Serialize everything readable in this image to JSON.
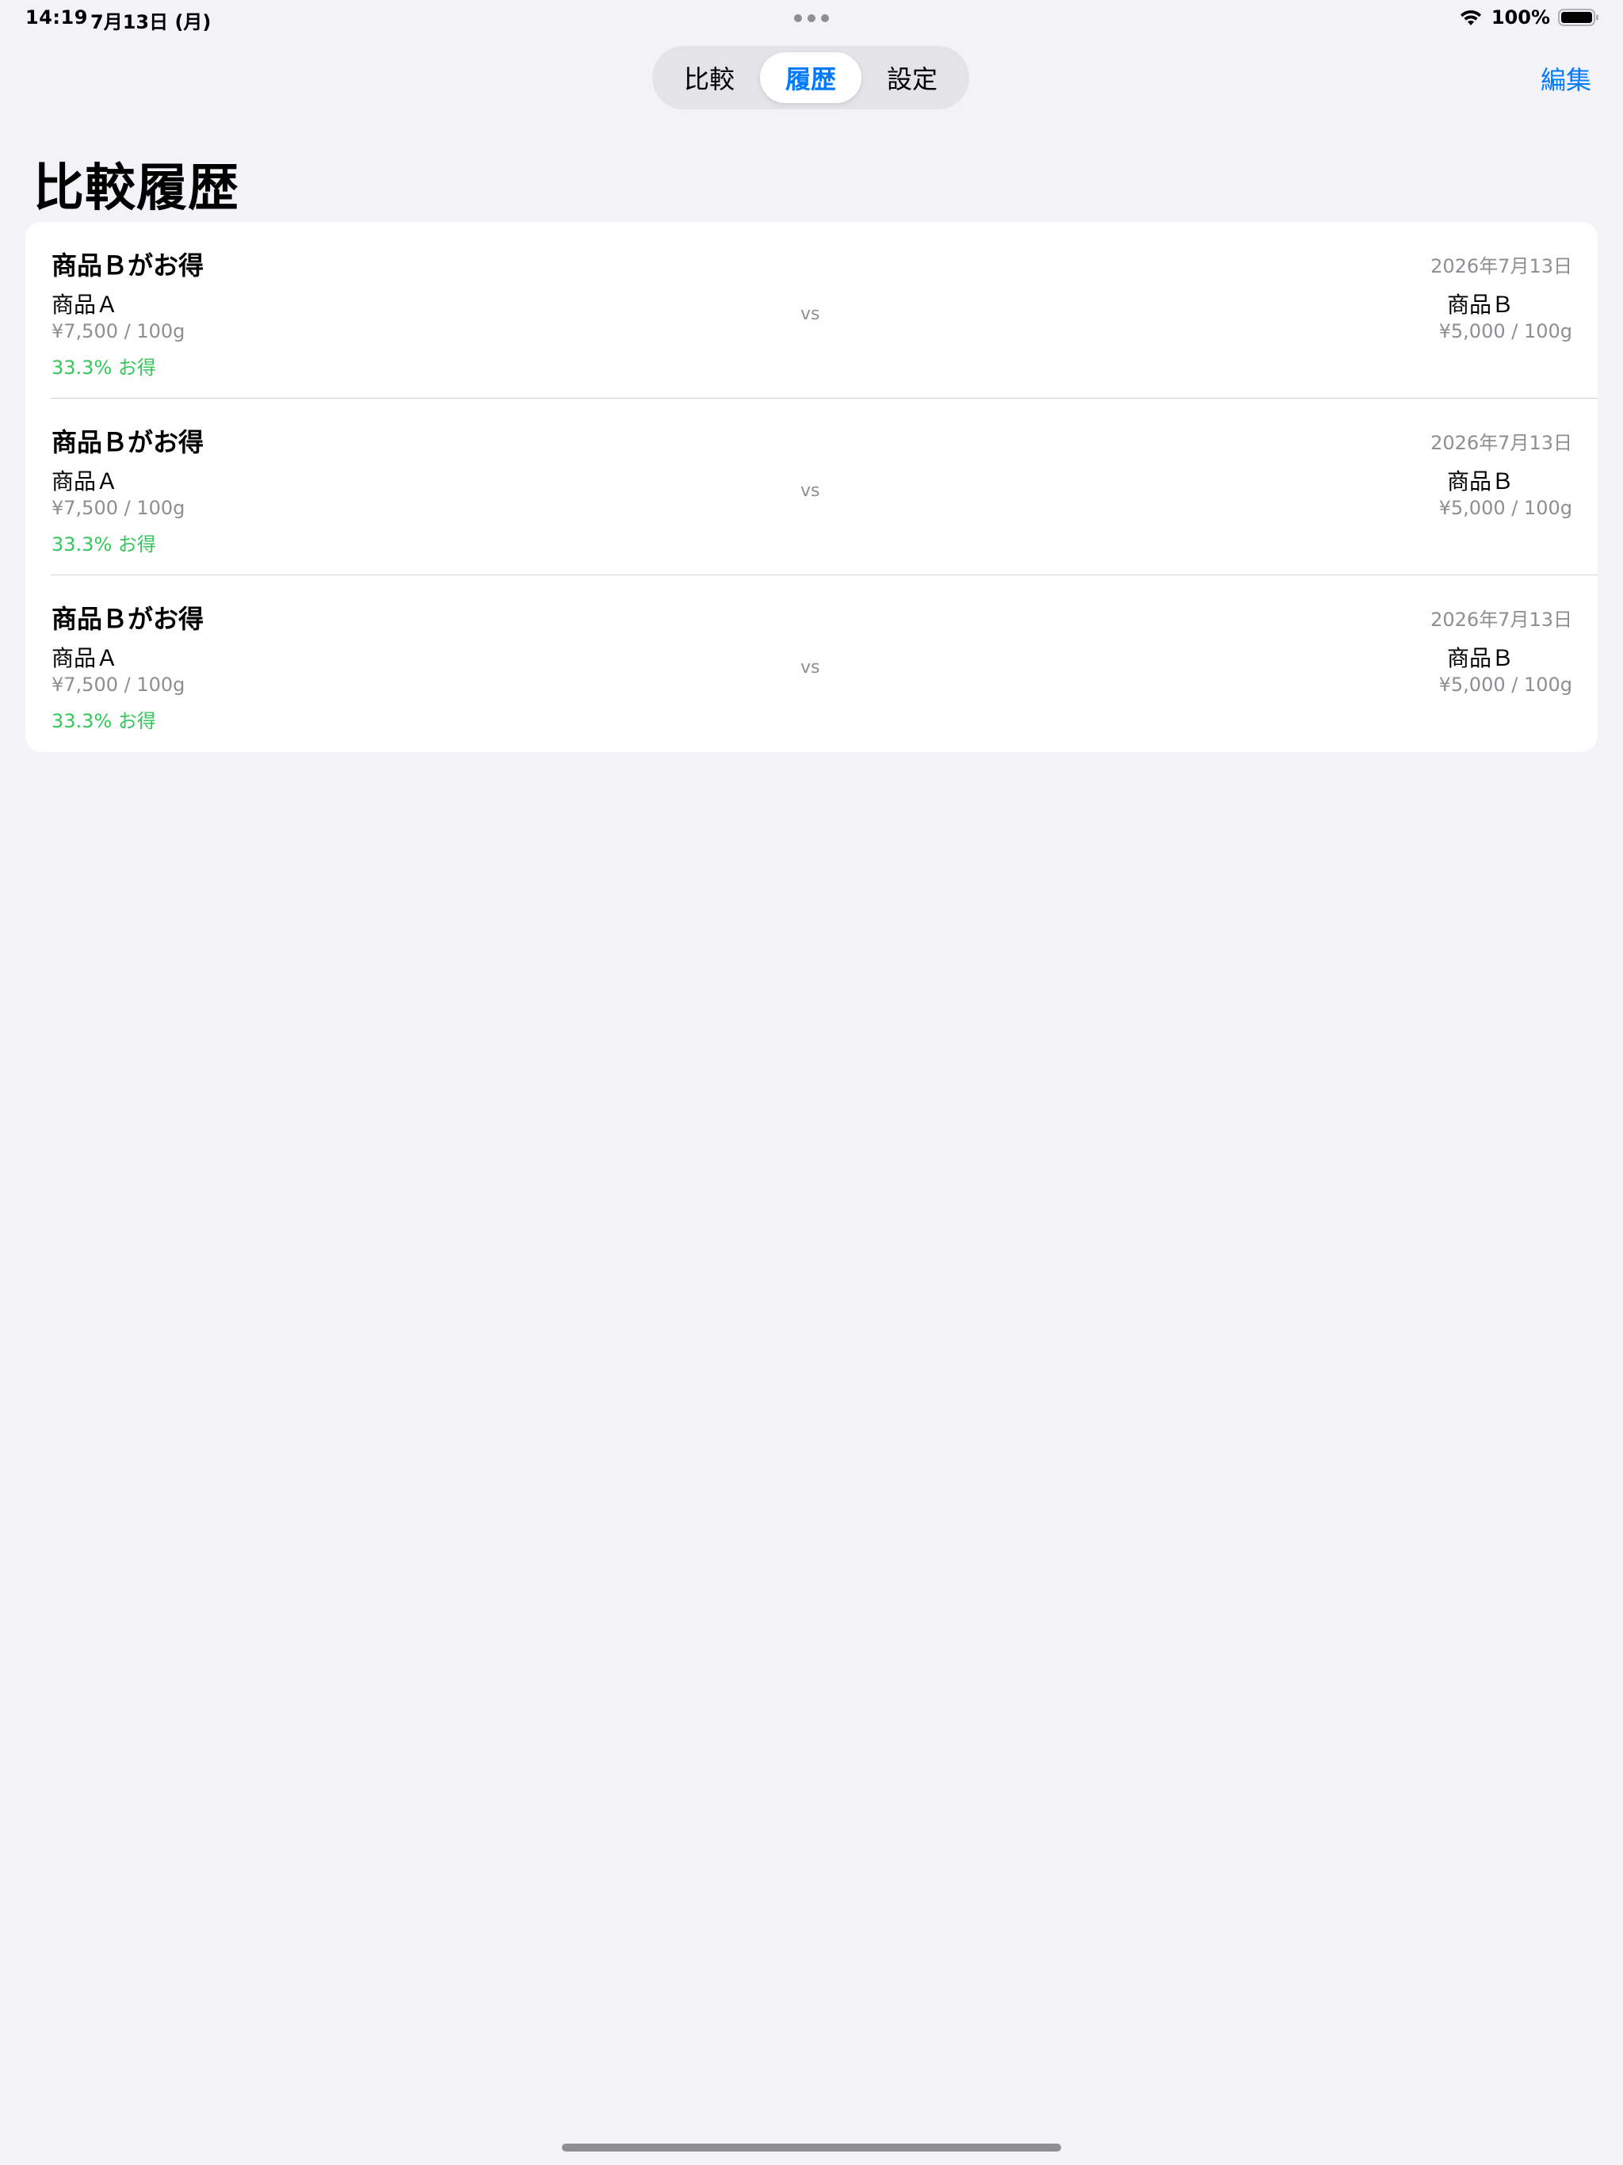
{
  "status_bar": {
    "time": "14:19",
    "date": "7月13日 (月)",
    "battery_percent": "100%",
    "battery_level": 1.0,
    "icons": [
      "wifi-icon",
      "battery-icon"
    ]
  },
  "tabs": [
    {
      "label": "比較",
      "active": false
    },
    {
      "label": "履歴",
      "active": true
    },
    {
      "label": "設定",
      "active": false
    }
  ],
  "toolbar": {
    "edit_label": "編集"
  },
  "page": {
    "title": "比較履歴"
  },
  "colors": {
    "accent": "#007aff",
    "savings": "#34c759",
    "secondary_text": "#8e8e93",
    "background": "#f2f2f7"
  },
  "history": {
    "items": [
      {
        "title": "商品Ｂがお得",
        "date": "2026年7月13日",
        "product_a": {
          "name": "商品Ａ",
          "price": "¥7,500 / 100g"
        },
        "savings": "33.3% お得",
        "vs": "vs",
        "product_b": {
          "name": "商品Ｂ",
          "price": "¥5,000 / 100g"
        }
      },
      {
        "title": "商品Ｂがお得",
        "date": "2026年7月13日",
        "product_a": {
          "name": "商品Ａ",
          "price": "¥7,500 / 100g"
        },
        "savings": "33.3% お得",
        "vs": "vs",
        "product_b": {
          "name": "商品Ｂ",
          "price": "¥5,000 / 100g"
        }
      },
      {
        "title": "商品Ｂがお得",
        "date": "2026年7月13日",
        "product_a": {
          "name": "商品Ａ",
          "price": "¥7,500 / 100g"
        },
        "savings": "33.3% お得",
        "vs": "vs",
        "product_b": {
          "name": "商品Ｂ",
          "price": "¥5,000 / 100g"
        }
      }
    ]
  }
}
